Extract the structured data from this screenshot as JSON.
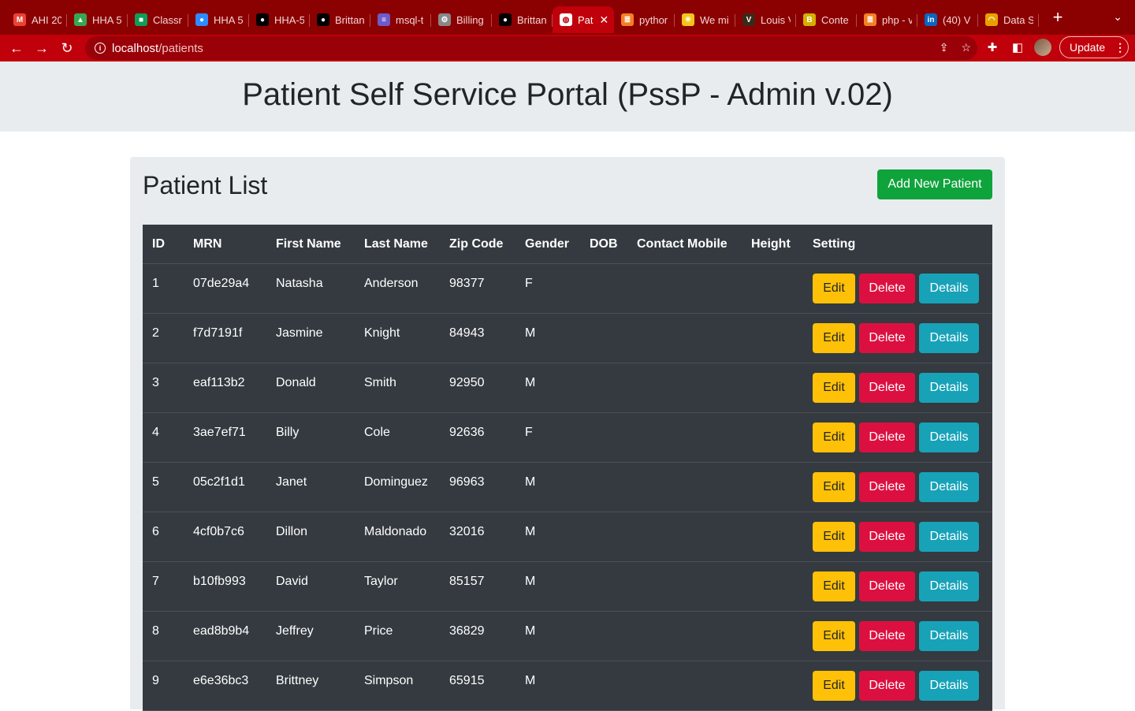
{
  "browser": {
    "tabs": [
      {
        "title": "AHI 20",
        "icon": "gmail-icon",
        "color": "#ea4335",
        "glyph": "M"
      },
      {
        "title": "HHA 5",
        "icon": "drive-icon",
        "color": "#34a853",
        "glyph": "▲"
      },
      {
        "title": "Classr",
        "icon": "classroom-icon",
        "color": "#0f9d58",
        "glyph": "■"
      },
      {
        "title": "HHA 5",
        "icon": "zoom-icon",
        "color": "#2d8cff",
        "glyph": "●"
      },
      {
        "title": "HHA-5",
        "icon": "github-icon",
        "color": "#000000",
        "glyph": "●"
      },
      {
        "title": "Brittan",
        "icon": "github-icon",
        "color": "#000000",
        "glyph": "●"
      },
      {
        "title": "msql-t",
        "icon": "stack-icon",
        "color": "#6e5ac8",
        "glyph": "≡"
      },
      {
        "title": "Billing",
        "icon": "gear-icon",
        "color": "#888888",
        "glyph": "⚙"
      },
      {
        "title": "Brittan",
        "icon": "github-icon",
        "color": "#000000",
        "glyph": "●"
      },
      {
        "title": "Pat",
        "icon": "globe-icon",
        "color": "#ffffff",
        "glyph": "◍",
        "active": true
      },
      {
        "title": "pythor",
        "icon": "stackoverflow-icon",
        "color": "#f48024",
        "glyph": "≣"
      },
      {
        "title": "We mi",
        "icon": "asterisk-icon",
        "color": "#f5c518",
        "glyph": "✳"
      },
      {
        "title": "Louis V",
        "icon": "lv-icon",
        "color": "#3b2a1a",
        "glyph": "V"
      },
      {
        "title": "Conte",
        "icon": "behance-icon",
        "color": "#d4b000",
        "glyph": "B"
      },
      {
        "title": "php - v",
        "icon": "stackoverflow-icon",
        "color": "#f48024",
        "glyph": "≣"
      },
      {
        "title": "(40) V",
        "icon": "linkedin-icon",
        "color": "#0a66c2",
        "glyph": "in"
      },
      {
        "title": "Data S",
        "icon": "rainbow-icon",
        "color": "#e8a200",
        "glyph": "◠"
      }
    ],
    "tab_close": "✕",
    "new_tab": "+",
    "url_host": "localhost",
    "url_path": "/patients",
    "update_label": "Update"
  },
  "header": {
    "title": "Patient Self Service Portal (PssP - Admin v.02)"
  },
  "card": {
    "title": "Patient List",
    "add_label": "Add New Patient"
  },
  "table": {
    "columns": [
      "ID",
      "MRN",
      "First Name",
      "Last Name",
      "Zip Code",
      "Gender",
      "DOB",
      "Contact Mobile",
      "Height",
      "Setting"
    ],
    "actions": {
      "edit": "Edit",
      "delete": "Delete",
      "details": "Details"
    },
    "rows": [
      {
        "id": "1",
        "mrn": "07de29a4",
        "first": "Natasha",
        "last": "Anderson",
        "zip": "98377",
        "gender": "F",
        "dob": "",
        "mobile": "",
        "height": ""
      },
      {
        "id": "2",
        "mrn": "f7d7191f",
        "first": "Jasmine",
        "last": "Knight",
        "zip": "84943",
        "gender": "M",
        "dob": "",
        "mobile": "",
        "height": ""
      },
      {
        "id": "3",
        "mrn": "eaf113b2",
        "first": "Donald",
        "last": "Smith",
        "zip": "92950",
        "gender": "M",
        "dob": "",
        "mobile": "",
        "height": ""
      },
      {
        "id": "4",
        "mrn": "3ae7ef71",
        "first": "Billy",
        "last": "Cole",
        "zip": "92636",
        "gender": "F",
        "dob": "",
        "mobile": "",
        "height": ""
      },
      {
        "id": "5",
        "mrn": "05c2f1d1",
        "first": "Janet",
        "last": "Dominguez",
        "zip": "96963",
        "gender": "M",
        "dob": "",
        "mobile": "",
        "height": ""
      },
      {
        "id": "6",
        "mrn": "4cf0b7c6",
        "first": "Dillon",
        "last": "Maldonado",
        "zip": "32016",
        "gender": "M",
        "dob": "",
        "mobile": "",
        "height": ""
      },
      {
        "id": "7",
        "mrn": "b10fb993",
        "first": "David",
        "last": "Taylor",
        "zip": "85157",
        "gender": "M",
        "dob": "",
        "mobile": "",
        "height": ""
      },
      {
        "id": "8",
        "mrn": "ead8b9b4",
        "first": "Jeffrey",
        "last": "Price",
        "zip": "36829",
        "gender": "M",
        "dob": "",
        "mobile": "",
        "height": ""
      },
      {
        "id": "9",
        "mrn": "e6e36bc3",
        "first": "Brittney",
        "last": "Simpson",
        "zip": "65915",
        "gender": "M",
        "dob": "",
        "mobile": "",
        "height": ""
      }
    ]
  }
}
